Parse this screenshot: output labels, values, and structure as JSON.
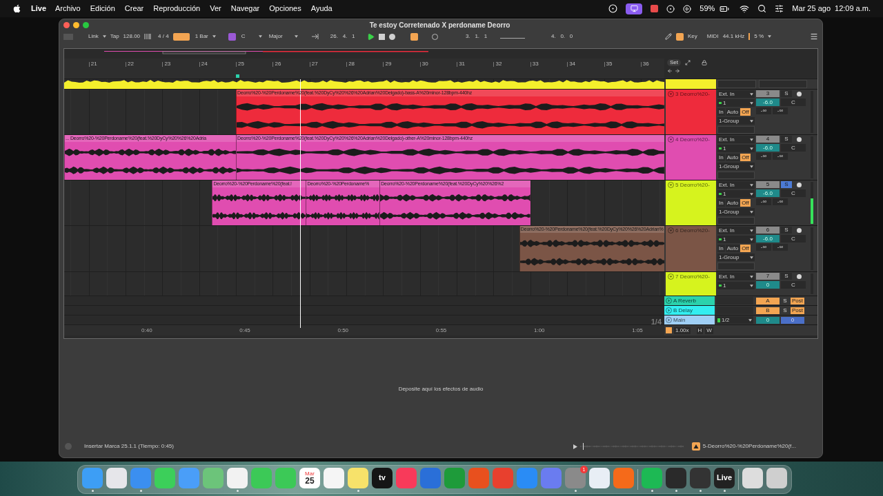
{
  "menu_bar": {
    "app_name": "Live",
    "items": [
      "Archivo",
      "Edición",
      "Crear",
      "Reproducción",
      "Ver",
      "Navegar",
      "Opciones",
      "Ayuda"
    ],
    "battery": "59%",
    "date": "Mar 25 ago",
    "time": "12:09 a.m."
  },
  "window": {
    "title": "Te estoy Corretenado X perdoname Deorro"
  },
  "toolbar": {
    "link": "Link",
    "tap": "Tap",
    "tempo": "128.00",
    "signature": "4 / 4",
    "quantization": "1 Bar",
    "key_root": "C",
    "scale": "Major",
    "position": "26.   4.   1",
    "loop_start": "3.   1.   1",
    "loop_length": "4.   0.   0",
    "key_button": "Key",
    "midi_button": "MIDI",
    "sample_rate": "44.1 kHz",
    "cpu": "5 %"
  },
  "arrangement": {
    "set_button": "Set",
    "bars": [
      "21",
      "22",
      "23",
      "24",
      "25",
      "26",
      "27",
      "28",
      "29",
      "30",
      "31",
      "32",
      "33",
      "34",
      "35",
      "36"
    ],
    "times": [
      "0:40",
      "0:45",
      "0:50",
      "0:55",
      "1:00",
      "1:05"
    ],
    "zoom": "1/4",
    "tracks": [
      {
        "kind": "group",
        "color": "#f4ef2c"
      },
      {
        "kind": "audio",
        "name": "3 Deorro%20-",
        "color": "#ee2b3c",
        "input": "Ext. In",
        "channel": "1",
        "monitor": [
          {
            "label": "In",
            "selected": false
          },
          {
            "label": "Auto",
            "selected": false
          },
          {
            "label": "Off",
            "selected": true
          }
        ],
        "output": "1-Group",
        "number": "3",
        "solo": {
          "label": "S",
          "selected": false
        },
        "volume": "-6.0",
        "pan": "C",
        "sends": [
          "-∞",
          "-∞"
        ],
        "meter": {
          "level": 0
        },
        "clips": [
          {
            "label": "Deorro%20-%20Perdoname%20(feat.%20DyCy%20%26%20Adrian%20Delgado)-bass-A%20minor-128bpm-440hz",
            "color": "#ee2b3c"
          }
        ]
      },
      {
        "kind": "audio",
        "name": "4 Deorro%20-",
        "color": "#e04db0",
        "input": "Ext. In",
        "channel": "1",
        "monitor": [
          {
            "label": "In",
            "selected": false
          },
          {
            "label": "Auto",
            "selected": false
          },
          {
            "label": "Off",
            "selected": true
          }
        ],
        "output": "1-Group",
        "number": "4",
        "solo": {
          "label": "S",
          "selected": false
        },
        "volume": "-6.0",
        "pan": "C",
        "sends": [
          "-∞",
          "-∞"
        ],
        "meter": {
          "level": 0
        },
        "clips": [
          {
            "label": "... Deorro%20-%20Perdoname%20(feat.%20DyCy%20%26%20Adria",
            "color": "#e04db0"
          },
          {
            "label": "Deorro%20-%20Perdoname%20(feat.%20DyCy%20%26%20Adrian%20Delgado)-other-A%20minor-128bpm-440hz",
            "color": "#e04db0"
          }
        ]
      },
      {
        "kind": "audio",
        "name": "5 Deorro%20-",
        "color": "#d6f31e",
        "input": "Ext. In",
        "channel": "1",
        "monitor": [
          {
            "label": "In",
            "selected": false
          },
          {
            "label": "Auto",
            "selected": false
          },
          {
            "label": "Off",
            "selected": true
          }
        ],
        "output": "1-Group",
        "number": "5",
        "solo": {
          "label": "S",
          "selected": true
        },
        "volume": "-6.0",
        "pan": "C",
        "sends": [
          "-∞",
          "-∞"
        ],
        "meter": {
          "level": 0.6
        },
        "clips": [
          {
            "label": "Deorro%20-%20Perdoname%20(feat.!",
            "color": "#e04db0"
          },
          {
            "label": "Deorro%20-%20Perdoname%",
            "color": "#e04db0"
          },
          {
            "label": "Deorro%20-%20Perdoname%20(feat.%20DyCy%20%26%2",
            "color": "#e04db0"
          }
        ]
      },
      {
        "kind": "audio",
        "name": "6 Deorro%20-",
        "color": "#7b5546",
        "input": "Ext. In",
        "channel": "1",
        "monitor": [
          {
            "label": "In",
            "selected": false
          },
          {
            "label": "Auto",
            "selected": false
          },
          {
            "label": "Off",
            "selected": true
          }
        ],
        "output": "1-Group",
        "number": "6",
        "solo": {
          "label": "S",
          "selected": false
        },
        "volume": "-6.0",
        "pan": "C",
        "sends": [
          "-∞",
          "-∞"
        ],
        "meter": {
          "level": 0
        },
        "clips": [
          {
            "label": "Deorro%20-%20Perdoname%20(feat.%20DyCy%20%26%20Adrian%",
            "color": "#7b5546"
          }
        ]
      },
      {
        "kind": "audio",
        "name": "7 Deorro%20-",
        "color": "#d6f31e",
        "input": "Ext. In",
        "channel": "1",
        "number": "7",
        "solo": {
          "label": "S",
          "selected": false
        },
        "volume": "0",
        "pan": "C",
        "meter": {
          "level": 0
        }
      }
    ],
    "returns": [
      {
        "name": "A Reverb",
        "color": "#2bd2ac",
        "send": "A",
        "solo": "S",
        "mode": "Post"
      },
      {
        "name": "B Delay",
        "color": "#33eef0",
        "send": "B",
        "solo": "S",
        "mode": "Post"
      }
    ],
    "main": {
      "name": "Main",
      "color": "#9fcff5",
      "output": "1/2",
      "volume": "0",
      "pan": "0"
    },
    "footer": {
      "speed": "1.00x",
      "h_button": "H",
      "w_button": "W"
    }
  },
  "device_area": {
    "hint": "Deposite aquí los efectos de audio"
  },
  "status_bar": {
    "message": "Insertar Marca 25.1.1 (Tiempo: 0:45)",
    "selected_clip": "5-Deorro%20-%20Perdoname%20(f..."
  },
  "dock": {
    "apps": [
      {
        "color": "#3d9ef5",
        "running": true
      },
      {
        "color": "#e6e6ea",
        "running": false
      },
      {
        "color": "#3b8ff0",
        "running": true
      },
      {
        "color": "#3ccf5a",
        "running": false
      },
      {
        "color": "#4a9ef8",
        "running": false
      },
      {
        "color": "#6cc47a",
        "running": false
      },
      {
        "color": "#f2f2f2",
        "running": true
      },
      {
        "color": "#3cc957",
        "running": false
      },
      {
        "color": "#3cc957",
        "running": false
      },
      {
        "color": "#ffffff",
        "label": "25",
        "sublabel": "Mar",
        "running": false
      },
      {
        "color": "#f5f5f5",
        "running": false
      },
      {
        "color": "#f7e26a",
        "running": true
      },
      {
        "color": "#151515",
        "label": "tv",
        "running": false
      },
      {
        "color": "#f83a5a",
        "running": false
      },
      {
        "color": "#2a6fd8",
        "running": false
      },
      {
        "color": "#1e9b3a",
        "running": false
      },
      {
        "color": "#e8501e",
        "running": false
      },
      {
        "color": "#e8402e",
        "running": false
      },
      {
        "color": "#2a8cf5",
        "running": false
      },
      {
        "color": "#6a7cf0",
        "running": false
      },
      {
        "color": "#8a8a8a",
        "badge": "1",
        "running": true
      },
      {
        "color": "#e8eef5",
        "running": false
      },
      {
        "color": "#f56a1a",
        "running": false
      },
      {
        "color": "#1db954",
        "running": true
      },
      {
        "color": "#2a2a2a",
        "running": true
      },
      {
        "color": "#333333",
        "running": true
      },
      {
        "color": "#222222",
        "label": "Live",
        "running": true
      },
      {
        "color": "#dddddd",
        "running": false
      },
      {
        "color": "#cfcfcf",
        "running": false
      }
    ]
  }
}
